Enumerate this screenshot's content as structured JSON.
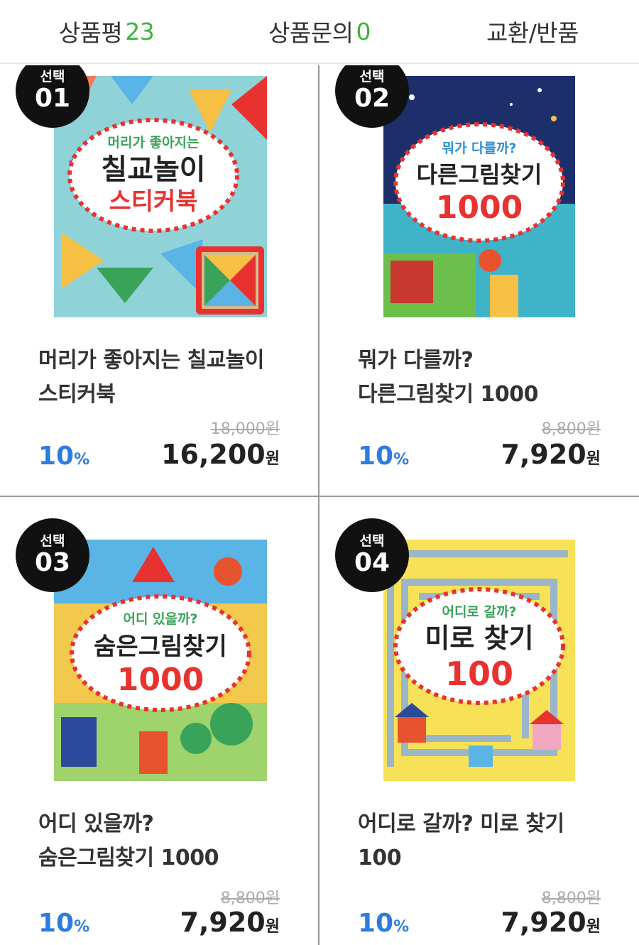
{
  "tabs": [
    {
      "label": "상품평",
      "count": "23"
    },
    {
      "label": "상품문의",
      "count": "0"
    },
    {
      "label": "교환/반품",
      "count": ""
    }
  ],
  "badge_label": "선택",
  "products": [
    {
      "number": "01",
      "title_line1": "머리가 좋아지는 칠교놀이",
      "title_line2": "스티커북",
      "original_price": "18,000원",
      "discount": "10",
      "discount_unit": "%",
      "price": "16,200",
      "price_unit": "원",
      "cover": {
        "subtitle": "머리가 좋아지는",
        "title": "칠교놀이",
        "title2": "스티커북",
        "bg": "#8fd3d9",
        "accent": "#e8322f"
      }
    },
    {
      "number": "02",
      "title_line1": "뭐가 다를까?",
      "title_line2": "다른그림찾기 1000",
      "original_price": "8,800원",
      "discount": "10",
      "discount_unit": "%",
      "price": "7,920",
      "price_unit": "원",
      "cover": {
        "subtitle": "뭐가 다를까?",
        "title": "다른그림찾기",
        "title2": "1000",
        "bg": "#1d2f6b",
        "accent": "#e8322f"
      }
    },
    {
      "number": "03",
      "title_line1": "어디 있을까?",
      "title_line2": "숨은그림찾기 1000",
      "original_price": "8,800원",
      "discount": "10",
      "discount_unit": "%",
      "price": "7,920",
      "price_unit": "원",
      "cover": {
        "subtitle": "어디 있을까?",
        "title": "숨은그림찾기",
        "title2": "1000",
        "bg": "#f2c94c",
        "accent": "#e8322f"
      }
    },
    {
      "number": "04",
      "title_line1": "어디로 갈까? 미로 찾기",
      "title_line2": "100",
      "original_price": "8,800원",
      "discount": "10",
      "discount_unit": "%",
      "price": "7,920",
      "price_unit": "원",
      "cover": {
        "subtitle": "어디로 갈까?",
        "title": "미로 찾기",
        "title2": "100",
        "bg": "#f7e257",
        "accent": "#e8322f"
      }
    }
  ]
}
